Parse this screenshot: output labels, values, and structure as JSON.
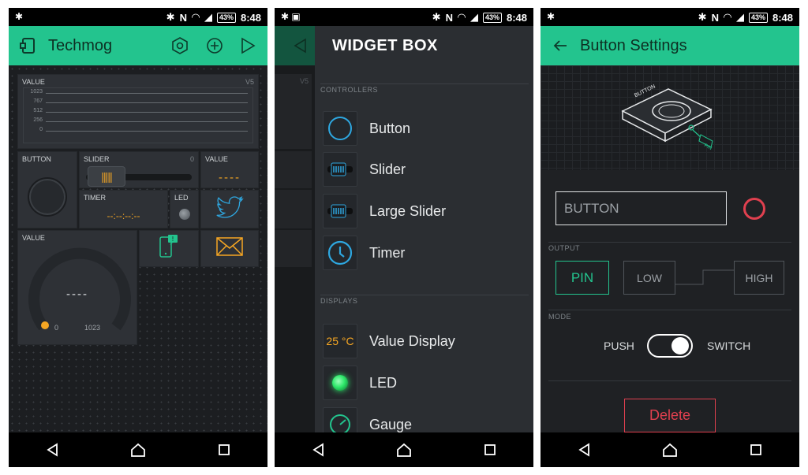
{
  "status_bar": {
    "time": "8:48",
    "battery": "43%",
    "icons": [
      "bluetooth-icon",
      "nfc-icon",
      "wifi-icon",
      "signal-icon"
    ]
  },
  "colors": {
    "accent": "#23c48e",
    "orange": "#f5a623",
    "blue": "#2ea7e0",
    "red": "#e0404f",
    "led_green": "#2ee86a",
    "bg": "#1f2124"
  },
  "screen1": {
    "title": "Techmog",
    "chart_tile": {
      "label": "VALUE",
      "pin": "V5",
      "ticks": [
        "1023",
        "767",
        "512",
        "256",
        "0"
      ]
    },
    "button_tile": {
      "label": "BUTTON"
    },
    "slider_tile": {
      "label": "SLIDER",
      "value": "0"
    },
    "value_tile": {
      "label": "VALUE",
      "value": "----"
    },
    "timer_tile": {
      "label": "TIMER",
      "value": "--:--:--:--"
    },
    "led_tile": {
      "label": "LED"
    },
    "gauge_tile": {
      "label": "VALUE",
      "value": "----",
      "min": "0",
      "max": "1023"
    }
  },
  "screen2": {
    "title": "WIDGET BOX",
    "behind_pin": "V5",
    "sections": [
      {
        "title": "CONTROLLERS",
        "items": [
          {
            "label": "Button",
            "icon": "button-circle-icon"
          },
          {
            "label": "Slider",
            "icon": "slider-icon"
          },
          {
            "label": "Large Slider",
            "icon": "large-slider-icon"
          },
          {
            "label": "Timer",
            "icon": "clock-icon"
          }
        ]
      },
      {
        "title": "DISPLAYS",
        "items": [
          {
            "label": "Value Display",
            "icon_text": "25 °C"
          },
          {
            "label": "LED",
            "icon": "led-icon"
          },
          {
            "label": "Gauge",
            "icon": "gauge-icon"
          }
        ]
      }
    ]
  },
  "screen3": {
    "title": "Button Settings",
    "device_label": "BUTTON",
    "pin_tag": "PIN",
    "name_value": "BUTTON",
    "output_label": "OUTPUT",
    "pin_button": "PIN",
    "low": "LOW",
    "high": "HIGH",
    "mode_label": "MODE",
    "push": "PUSH",
    "switch": "SWITCH",
    "switch_on": true,
    "delete": "Delete"
  }
}
